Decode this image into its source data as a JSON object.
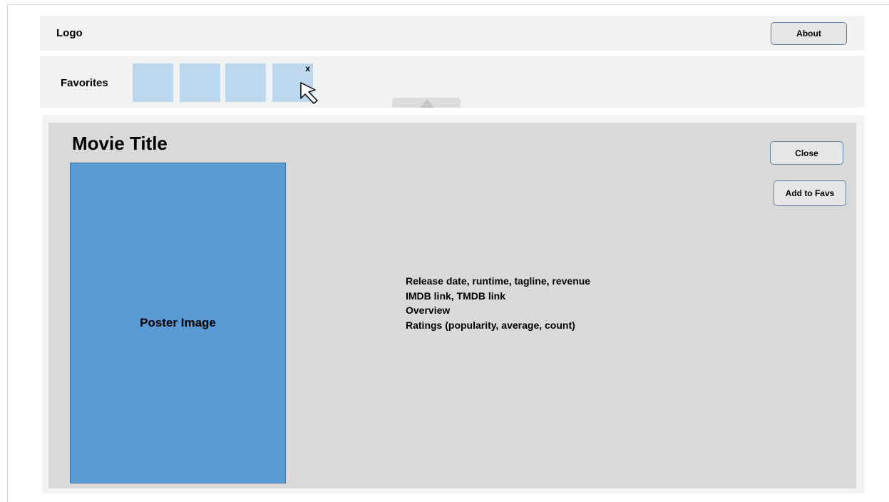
{
  "header": {
    "logo": "Logo",
    "about_label": "About"
  },
  "favorites": {
    "label": "Favorites",
    "remove_label": "x",
    "thumbs": [
      "",
      "",
      "",
      ""
    ]
  },
  "details": {
    "movie_title": "Movie Title",
    "poster_label": "Poster Image",
    "close_label": "Close",
    "add_to_favs_label": "Add to Favs",
    "info_lines": [
      "Release date, runtime, tagline, revenue",
      "IMDB link, TMDB link",
      "Overview",
      "Ratings (popularity, average, count)"
    ]
  },
  "icons": {
    "cursor": "mouse-pointer-icon",
    "collapse": "triangle-up-icon"
  },
  "colors": {
    "poster_fill": "#5b9bd5",
    "thumb_fill": "#bdd7ee",
    "panel_bg": "#d9d9d9",
    "bar_bg": "#f2f2f2",
    "button_border": "#5b7fa6"
  }
}
